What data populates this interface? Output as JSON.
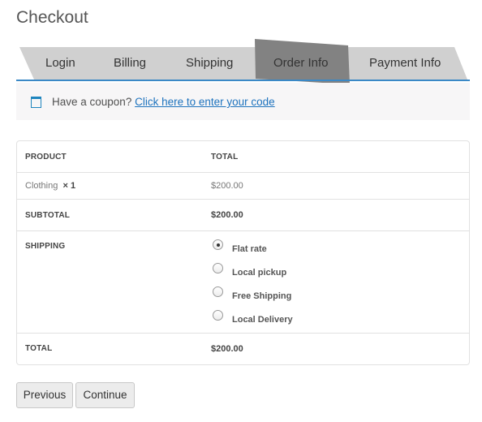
{
  "page": {
    "title": "Checkout"
  },
  "tabs": [
    {
      "label": "Login",
      "active": false
    },
    {
      "label": "Billing",
      "active": false
    },
    {
      "label": "Shipping",
      "active": false
    },
    {
      "label": "Order Info",
      "active": true
    },
    {
      "label": "Payment Info",
      "active": false
    }
  ],
  "coupon": {
    "icon": "window-icon",
    "text": "Have a coupon?",
    "link": "Click here to enter your code"
  },
  "table": {
    "headers": {
      "product": "PRODUCT",
      "total": "TOTAL"
    },
    "item": {
      "name": "Clothing",
      "qty": "× 1",
      "price": "$200.00"
    },
    "subtotal": {
      "label": "SUBTOTAL",
      "value": "$200.00"
    },
    "shipping": {
      "label": "SHIPPING",
      "options": [
        {
          "label": "Flat rate",
          "checked": true
        },
        {
          "label": "Local pickup",
          "checked": false
        },
        {
          "label": "Free Shipping",
          "checked": false
        },
        {
          "label": "Local Delivery",
          "checked": false
        }
      ]
    },
    "total": {
      "label": "TOTAL",
      "value": "$200.00"
    }
  },
  "buttons": {
    "previous": "Previous",
    "continue": "Continue"
  },
  "colors": {
    "accent": "#3a88c6",
    "link": "#1e73be",
    "tab_inactive": "#d0d0d0",
    "tab_active": "#828282"
  }
}
